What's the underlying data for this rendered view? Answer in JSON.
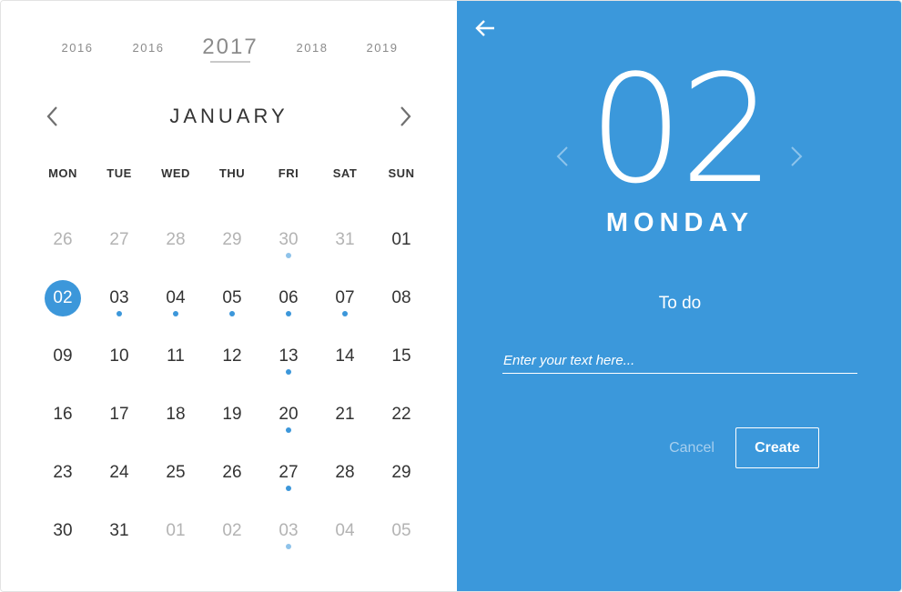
{
  "calendar": {
    "years": [
      "2016",
      "2016",
      "2017",
      "2018",
      "2019"
    ],
    "active_year_index": 2,
    "month": "JANUARY",
    "weekdays": [
      "MON",
      "TUE",
      "WED",
      "THU",
      "FRI",
      "SAT",
      "SUN"
    ],
    "weeks": [
      [
        {
          "d": "26",
          "muted": true
        },
        {
          "d": "27",
          "muted": true
        },
        {
          "d": "28",
          "muted": true
        },
        {
          "d": "29",
          "muted": true
        },
        {
          "d": "30",
          "muted": true,
          "event": true
        },
        {
          "d": "31",
          "muted": true
        },
        {
          "d": "01"
        }
      ],
      [
        {
          "d": "02",
          "selected": true
        },
        {
          "d": "03",
          "event": true
        },
        {
          "d": "04",
          "event": true
        },
        {
          "d": "05",
          "event": true
        },
        {
          "d": "06",
          "event": true
        },
        {
          "d": "07",
          "event": true
        },
        {
          "d": "08"
        }
      ],
      [
        {
          "d": "09"
        },
        {
          "d": "10"
        },
        {
          "d": "11"
        },
        {
          "d": "12"
        },
        {
          "d": "13",
          "event": true
        },
        {
          "d": "14"
        },
        {
          "d": "15"
        }
      ],
      [
        {
          "d": "16"
        },
        {
          "d": "17"
        },
        {
          "d": "18"
        },
        {
          "d": "19"
        },
        {
          "d": "20",
          "event": true
        },
        {
          "d": "21"
        },
        {
          "d": "22"
        }
      ],
      [
        {
          "d": "23"
        },
        {
          "d": "24"
        },
        {
          "d": "25"
        },
        {
          "d": "26"
        },
        {
          "d": "27",
          "event": true
        },
        {
          "d": "28"
        },
        {
          "d": "29"
        }
      ],
      [
        {
          "d": "30"
        },
        {
          "d": "31"
        },
        {
          "d": "01",
          "muted": true
        },
        {
          "d": "02",
          "muted": true
        },
        {
          "d": "03",
          "muted": true,
          "event": true
        },
        {
          "d": "04",
          "muted": true
        },
        {
          "d": "05",
          "muted": true
        }
      ]
    ]
  },
  "detail": {
    "day_number": "02",
    "weekday": "MONDAY",
    "todo_label": "To do",
    "input_placeholder": "Enter your text here...",
    "input_value": "",
    "cancel_label": "Cancel",
    "create_label": "Create"
  },
  "colors": {
    "accent": "#3b98db",
    "text": "#333333",
    "muted": "#b3b3b3"
  },
  "icons": {
    "back": "arrow-left-icon",
    "prev": "chevron-left-icon",
    "next": "chevron-right-icon"
  }
}
